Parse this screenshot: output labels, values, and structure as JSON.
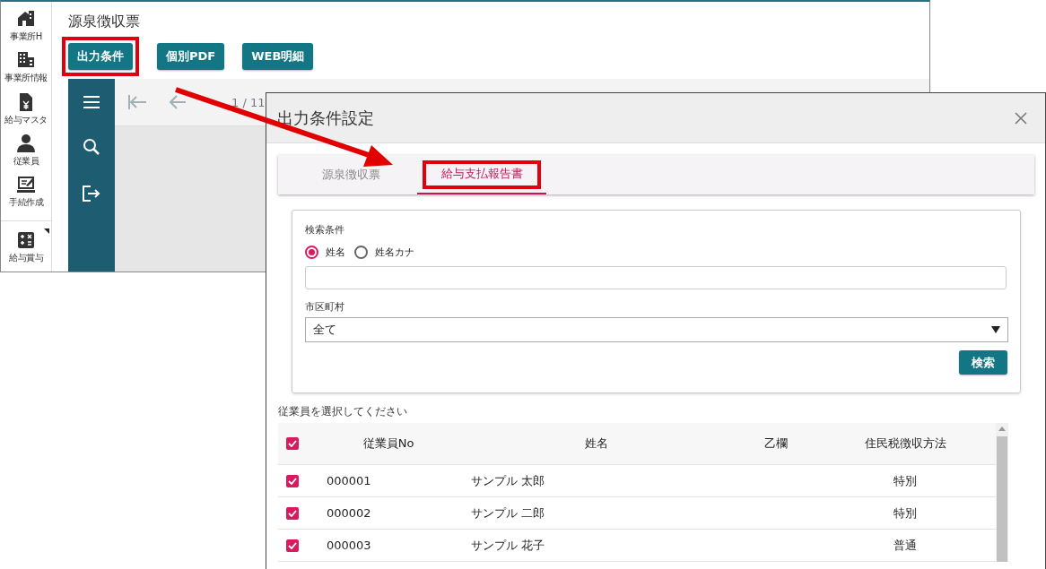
{
  "app": {
    "sidebar": [
      {
        "kind": "office-home",
        "label": "事業所H"
      },
      {
        "kind": "office",
        "label": "事業所情報"
      },
      {
        "kind": "salary",
        "label": "給与マスタ"
      },
      {
        "kind": "person",
        "label": "従業員"
      },
      {
        "kind": "procedure",
        "label": "手続作成"
      },
      {
        "kind": "calculator",
        "label": "給与賞与"
      }
    ],
    "title": "源泉徴収票",
    "buttons": [
      {
        "label": "出力条件",
        "highlighted": true
      },
      {
        "label": "個別PDF",
        "highlighted": false
      },
      {
        "label": "WEB明細",
        "highlighted": false
      }
    ],
    "viewer": {
      "page": "1 / 11"
    }
  },
  "dialog": {
    "title": "出力条件設定",
    "tabs": [
      {
        "label": "源泉徴収票",
        "selected": false,
        "highlighted": false
      },
      {
        "label": "給与支払報告書",
        "selected": true,
        "highlighted": true
      }
    ],
    "search": {
      "label": "検索条件",
      "radios": [
        {
          "label": "姓名",
          "selected": true
        },
        {
          "label": "姓名カナ",
          "selected": false
        }
      ],
      "city_label": "市区町村",
      "city_value": "全て",
      "button": "検索"
    },
    "table": {
      "instruction": "従業員を選択してください",
      "all_checked": true,
      "columns": [
        "従業員No",
        "姓名",
        "乙欄",
        "住民税徴収方法"
      ],
      "rows": [
        {
          "checked": true,
          "no": "000001",
          "name": "サンプル 太郎",
          "method": "特別"
        },
        {
          "checked": true,
          "no": "000002",
          "name": "サンプル 二郎",
          "method": "特別"
        },
        {
          "checked": true,
          "no": "000003",
          "name": "サンプル 花子",
          "method": "普通"
        }
      ]
    }
  }
}
